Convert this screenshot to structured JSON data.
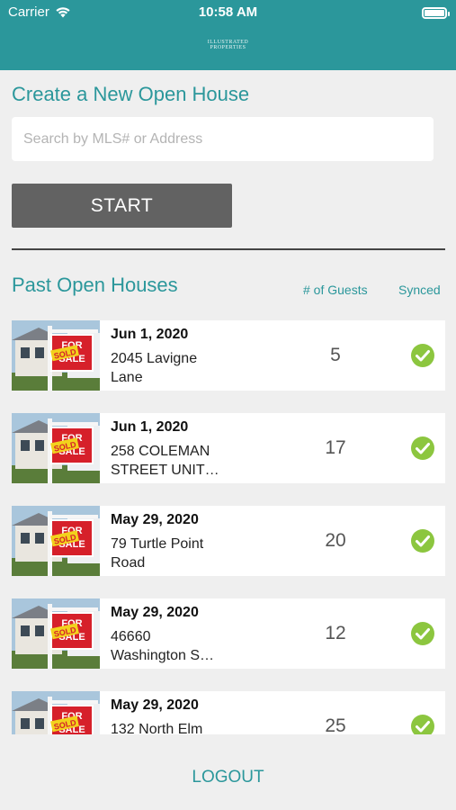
{
  "status_bar": {
    "carrier": "Carrier",
    "time": "10:58 AM"
  },
  "header": {
    "logo_line1": "ILLUSTRATED",
    "logo_line2": "PROPERTIES"
  },
  "create": {
    "title": "Create a New Open House",
    "search_placeholder": "Search by MLS# or Address",
    "search_value": "",
    "start_label": "START"
  },
  "past": {
    "title": "Past Open Houses",
    "col_guests": "# of Guests",
    "col_synced": "Synced",
    "rows": [
      {
        "date": "Jun 1, 2020",
        "addr1": "2045 Lavigne",
        "addr2": "Lane",
        "guests": "5",
        "synced": true
      },
      {
        "date": "Jun 1, 2020",
        "addr1": "258 COLEMAN",
        "addr2": "STREET UNIT…",
        "guests": "17",
        "synced": true
      },
      {
        "date": "May 29, 2020",
        "addr1": "79 Turtle Point",
        "addr2": "Road",
        "guests": "20",
        "synced": true
      },
      {
        "date": "May 29, 2020",
        "addr1": "46660",
        "addr2": "Washington S…",
        "guests": "12",
        "synced": true
      },
      {
        "date": "May 29, 2020",
        "addr1": "132 North Elm",
        "addr2": "",
        "guests": "25",
        "synced": true
      }
    ],
    "sign_text_for": "FOR",
    "sign_text_sale": "SALE",
    "sign_text_sold": "SOLD"
  },
  "logout_label": "LOGOUT",
  "colors": {
    "teal": "#2b979b",
    "button_gray": "#626262",
    "check_green": "#8cc63f"
  },
  "icons": {
    "wifi": "wifi-icon",
    "battery": "battery-icon",
    "check": "check-circle-icon"
  }
}
